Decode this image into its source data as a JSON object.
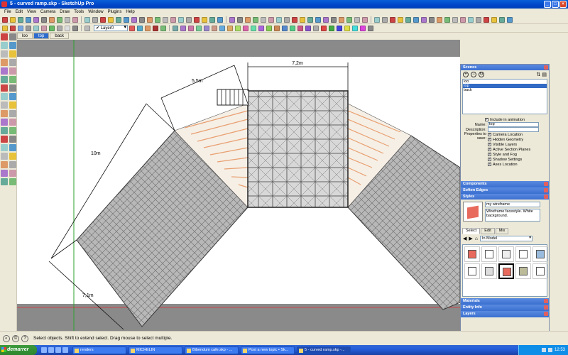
{
  "window": {
    "title": "5 - curved ramp.skp - SketchUp Pro"
  },
  "menu": [
    "File",
    "Edit",
    "View",
    "Camera",
    "Draw",
    "Tools",
    "Window",
    "Plugins",
    "Help"
  ],
  "layer": {
    "current": "Layer0"
  },
  "scene_tabs": [
    {
      "label": "loo",
      "active": false
    },
    {
      "label": "top",
      "active": true
    },
    {
      "label": "back",
      "active": false
    }
  ],
  "dimensions": {
    "d1": "7,2m",
    "d2": "5,5m",
    "d3": "10m",
    "d4": "7,1m"
  },
  "panels": {
    "scenes": {
      "title": "Scenes",
      "items": [
        {
          "label": "loo",
          "selected": false
        },
        {
          "label": "top",
          "selected": true
        },
        {
          "label": "back",
          "selected": false
        }
      ],
      "include_label": "Include in animation",
      "name_label": "Name:",
      "name_value": "top",
      "description_label": "Description:",
      "description_value": "",
      "properties_label": "Properties to save:",
      "properties": [
        "Camera Location",
        "Hidden Geometry",
        "Visible Layers",
        "Active Section Planes",
        "Style and Fog",
        "Shadow Settings",
        "Axes Location"
      ]
    },
    "components": {
      "title": "Components"
    },
    "soften": {
      "title": "Soften Edges"
    },
    "styles": {
      "title": "Styles",
      "name": "my wireframe",
      "description": "Wireframe facestyle. White background.",
      "tabs": [
        {
          "label": "Select",
          "active": true
        },
        {
          "label": "Edit",
          "active": false
        },
        {
          "label": "Mix",
          "active": false
        }
      ],
      "collection": "In Model"
    },
    "materials": {
      "title": "Materials"
    },
    "entity": {
      "title": "Entity Info"
    },
    "layers": {
      "title": "Layers"
    }
  },
  "status": {
    "message": "Select objects. Shift to extend select. Drag mouse to select multiple."
  },
  "taskbar": {
    "start": "demarrer",
    "tasks": [
      {
        "label": "renders",
        "active": false
      },
      {
        "label": "MICHELIN",
        "active": false
      },
      {
        "label": "Bibendum cafe.skp - ...",
        "active": false
      },
      {
        "label": "Post a new topic • Sk...",
        "active": false
      },
      {
        "label": "5 - curved ramp.skp -...",
        "active": true
      }
    ],
    "clock": "12:53"
  },
  "colors": {
    "title_bar": "#0a5fd8",
    "selection": "#316ac5",
    "panel_header": "#3b6fd0",
    "taskbar": "#245edb",
    "start": "#2d862d",
    "axis_green": "#2aa02a",
    "axis_red": "#e03030",
    "ramp_fill": "#b8b8b8",
    "deck_fill": "#cfcfcf",
    "beam_orange": "#e8a070"
  }
}
